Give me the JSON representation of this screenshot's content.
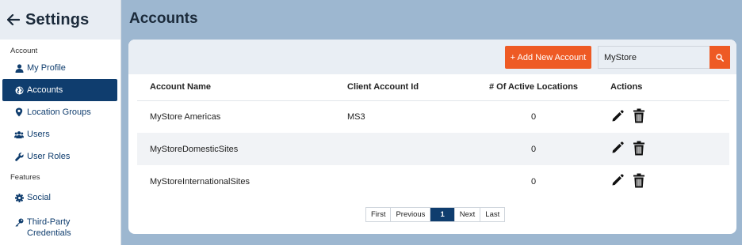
{
  "sidebar": {
    "title": "Settings",
    "sections": [
      {
        "label": "Account"
      },
      {
        "label": "Features"
      }
    ],
    "items": [
      {
        "label": "My Profile",
        "icon": "user-icon"
      },
      {
        "label": "Accounts",
        "icon": "globe-icon",
        "active": true
      },
      {
        "label": "Location Groups",
        "icon": "map-pin-icon"
      },
      {
        "label": "Users",
        "icon": "users-icon"
      },
      {
        "label": "User Roles",
        "icon": "wrench-icon"
      },
      {
        "label": "Social",
        "icon": "gear-icon"
      },
      {
        "label": "Third-Party Credentials",
        "icon": "key-icon"
      }
    ]
  },
  "main": {
    "title": "Accounts",
    "toolbar": {
      "add_label": "+ Add New Account",
      "search_value": "MyStore"
    },
    "table": {
      "headers": [
        "Account Name",
        "Client Account Id",
        "# Of Active Locations",
        "Actions"
      ],
      "rows": [
        {
          "name": "MyStore Americas",
          "client_id": "MS3",
          "active_locations": "0"
        },
        {
          "name": "MyStoreDomesticSites",
          "client_id": "",
          "active_locations": "0"
        },
        {
          "name": "MyStoreInternationalSites",
          "client_id": "",
          "active_locations": "0"
        }
      ]
    },
    "pagination": {
      "first": "First",
      "previous": "Previous",
      "current": "1",
      "next": "Next",
      "last": "Last"
    }
  },
  "colors": {
    "accent": "#ee5a24",
    "primary": "#0f3d6e",
    "background": "#9db7d0"
  }
}
